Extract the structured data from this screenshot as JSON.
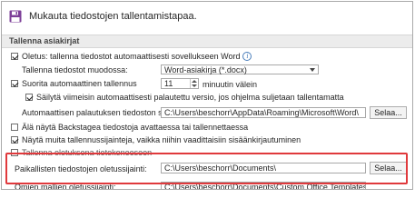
{
  "header": {
    "text": "Mukauta tiedostojen tallentamistapaa.",
    "icon": "floppy-disk-icon",
    "icon_color": "#7d3f98"
  },
  "section": {
    "title": "Tallenna asiakirjat"
  },
  "options": {
    "autosave_word": {
      "label": "Oletus: tallenna tiedostot automaattisesti sovellukseen Word",
      "checked": true
    },
    "save_format": {
      "label": "Tallenna tiedostot muodossa:",
      "value": "Word-asiakirja (*.docx)"
    },
    "autorecover": {
      "label": "Suorita automaattinen tallennus",
      "checked": true,
      "value": "11",
      "unit": "minuutin välein"
    },
    "keep_last": {
      "label": "Säilytä viimeisin automaattisesti palautettu versio, jos ohjelma suljetaan tallentamatta",
      "checked": true
    },
    "autorecover_location": {
      "label": "Automaattisen palautuksen tiedoston sijainti:",
      "value": "C:\\Users\\beschorr\\AppData\\Roaming\\Microsoft\\Word\\",
      "button": "Selaa..."
    },
    "no_backstage": {
      "label": "Älä näytä Backstagea tiedostoja avattaessa tai tallennettaessa",
      "checked": false
    },
    "show_more_locations": {
      "label": "Näytä muita tallennussijainteja, vaikka niihin vaadittaisiin sisäänkirjautuminen",
      "checked": true
    },
    "save_to_computer": {
      "label": "Tallenna oletuksena tietokoneeseen",
      "checked": false
    },
    "local_default": {
      "label": "Paikallisten tiedostojen oletussijainti:",
      "value": "C:\\Users\\beschorr\\Documents\\",
      "button": "Selaa..."
    },
    "templates_default": {
      "label": "Omien mallien oletussijainti:",
      "value": "C:\\Users\\beschorr\\Documents\\Custom Office Templates\\"
    }
  },
  "colors": {
    "highlight": "#e0393c",
    "section_bg": "#ececec",
    "info_icon": "#4a7ebb"
  }
}
